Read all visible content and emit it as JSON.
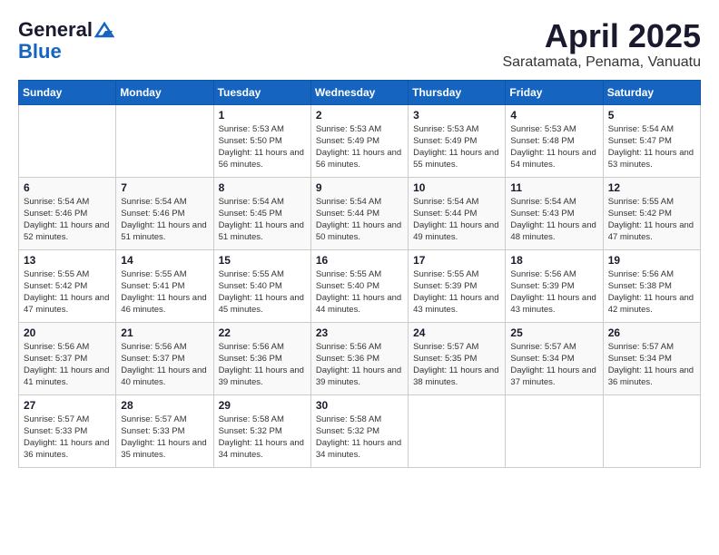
{
  "logo": {
    "general": "General",
    "blue": "Blue"
  },
  "title": "April 2025",
  "location": "Saratamata, Penama, Vanuatu",
  "days_of_week": [
    "Sunday",
    "Monday",
    "Tuesday",
    "Wednesday",
    "Thursday",
    "Friday",
    "Saturday"
  ],
  "weeks": [
    [
      {
        "day": "",
        "content": ""
      },
      {
        "day": "",
        "content": ""
      },
      {
        "day": "1",
        "content": "Sunrise: 5:53 AM\nSunset: 5:50 PM\nDaylight: 11 hours and 56 minutes."
      },
      {
        "day": "2",
        "content": "Sunrise: 5:53 AM\nSunset: 5:49 PM\nDaylight: 11 hours and 56 minutes."
      },
      {
        "day": "3",
        "content": "Sunrise: 5:53 AM\nSunset: 5:49 PM\nDaylight: 11 hours and 55 minutes."
      },
      {
        "day": "4",
        "content": "Sunrise: 5:53 AM\nSunset: 5:48 PM\nDaylight: 11 hours and 54 minutes."
      },
      {
        "day": "5",
        "content": "Sunrise: 5:54 AM\nSunset: 5:47 PM\nDaylight: 11 hours and 53 minutes."
      }
    ],
    [
      {
        "day": "6",
        "content": "Sunrise: 5:54 AM\nSunset: 5:46 PM\nDaylight: 11 hours and 52 minutes."
      },
      {
        "day": "7",
        "content": "Sunrise: 5:54 AM\nSunset: 5:46 PM\nDaylight: 11 hours and 51 minutes."
      },
      {
        "day": "8",
        "content": "Sunrise: 5:54 AM\nSunset: 5:45 PM\nDaylight: 11 hours and 51 minutes."
      },
      {
        "day": "9",
        "content": "Sunrise: 5:54 AM\nSunset: 5:44 PM\nDaylight: 11 hours and 50 minutes."
      },
      {
        "day": "10",
        "content": "Sunrise: 5:54 AM\nSunset: 5:44 PM\nDaylight: 11 hours and 49 minutes."
      },
      {
        "day": "11",
        "content": "Sunrise: 5:54 AM\nSunset: 5:43 PM\nDaylight: 11 hours and 48 minutes."
      },
      {
        "day": "12",
        "content": "Sunrise: 5:55 AM\nSunset: 5:42 PM\nDaylight: 11 hours and 47 minutes."
      }
    ],
    [
      {
        "day": "13",
        "content": "Sunrise: 5:55 AM\nSunset: 5:42 PM\nDaylight: 11 hours and 47 minutes."
      },
      {
        "day": "14",
        "content": "Sunrise: 5:55 AM\nSunset: 5:41 PM\nDaylight: 11 hours and 46 minutes."
      },
      {
        "day": "15",
        "content": "Sunrise: 5:55 AM\nSunset: 5:40 PM\nDaylight: 11 hours and 45 minutes."
      },
      {
        "day": "16",
        "content": "Sunrise: 5:55 AM\nSunset: 5:40 PM\nDaylight: 11 hours and 44 minutes."
      },
      {
        "day": "17",
        "content": "Sunrise: 5:55 AM\nSunset: 5:39 PM\nDaylight: 11 hours and 43 minutes."
      },
      {
        "day": "18",
        "content": "Sunrise: 5:56 AM\nSunset: 5:39 PM\nDaylight: 11 hours and 43 minutes."
      },
      {
        "day": "19",
        "content": "Sunrise: 5:56 AM\nSunset: 5:38 PM\nDaylight: 11 hours and 42 minutes."
      }
    ],
    [
      {
        "day": "20",
        "content": "Sunrise: 5:56 AM\nSunset: 5:37 PM\nDaylight: 11 hours and 41 minutes."
      },
      {
        "day": "21",
        "content": "Sunrise: 5:56 AM\nSunset: 5:37 PM\nDaylight: 11 hours and 40 minutes."
      },
      {
        "day": "22",
        "content": "Sunrise: 5:56 AM\nSunset: 5:36 PM\nDaylight: 11 hours and 39 minutes."
      },
      {
        "day": "23",
        "content": "Sunrise: 5:56 AM\nSunset: 5:36 PM\nDaylight: 11 hours and 39 minutes."
      },
      {
        "day": "24",
        "content": "Sunrise: 5:57 AM\nSunset: 5:35 PM\nDaylight: 11 hours and 38 minutes."
      },
      {
        "day": "25",
        "content": "Sunrise: 5:57 AM\nSunset: 5:34 PM\nDaylight: 11 hours and 37 minutes."
      },
      {
        "day": "26",
        "content": "Sunrise: 5:57 AM\nSunset: 5:34 PM\nDaylight: 11 hours and 36 minutes."
      }
    ],
    [
      {
        "day": "27",
        "content": "Sunrise: 5:57 AM\nSunset: 5:33 PM\nDaylight: 11 hours and 36 minutes."
      },
      {
        "day": "28",
        "content": "Sunrise: 5:57 AM\nSunset: 5:33 PM\nDaylight: 11 hours and 35 minutes."
      },
      {
        "day": "29",
        "content": "Sunrise: 5:58 AM\nSunset: 5:32 PM\nDaylight: 11 hours and 34 minutes."
      },
      {
        "day": "30",
        "content": "Sunrise: 5:58 AM\nSunset: 5:32 PM\nDaylight: 11 hours and 34 minutes."
      },
      {
        "day": "",
        "content": ""
      },
      {
        "day": "",
        "content": ""
      },
      {
        "day": "",
        "content": ""
      }
    ]
  ]
}
